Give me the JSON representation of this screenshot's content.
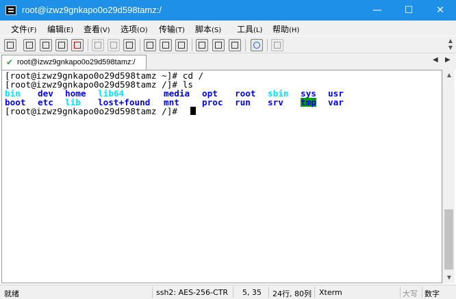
{
  "window": {
    "title": "root@izwz9gnkapo0o29d598tamz:/",
    "min_symbol": "—",
    "max_symbol": "☐",
    "close_symbol": "✕"
  },
  "menu": [
    {
      "label": "文件",
      "accel": "(F)"
    },
    {
      "label": "编辑",
      "accel": "(E)"
    },
    {
      "label": "查看",
      "accel": "(V)"
    },
    {
      "label": "选项",
      "accel": "(O)"
    },
    {
      "label": "传输",
      "accel": "(T)"
    },
    {
      "label": "脚本",
      "accel": "(S)"
    },
    {
      "label": "工具",
      "accel": "(L)"
    },
    {
      "label": "帮助",
      "accel": "(H)"
    }
  ],
  "toolbar_icons": [
    "connect-icon",
    "quick-connect-icon",
    "connect-tab-icon",
    "reconnect-icon",
    "disconnect-icon",
    "copy-icon",
    "paste-icon",
    "find-icon",
    "print-icon",
    "print-setup-icon",
    "printer-icon",
    "session-options-icon",
    "global-options-icon",
    "keymap-icon",
    "help-icon",
    "sftp-icon"
  ],
  "tab": {
    "label": "root@izwz9gnkapo0o29d598tamz:/",
    "status": "connected"
  },
  "colors": {
    "titlebar": "#1e90e8",
    "dir_blue": "#0000ff",
    "link_cyan": "#00e5ff",
    "tmp_bg": "#00a000",
    "tmp_fg": "#0000ff",
    "prompt": "#000000"
  },
  "terminal": {
    "line1": "[root@izwz9gnkapo0o29d598tamz ~]# cd /",
    "line2": "[root@izwz9gnkapo0o29d598tamz /]# ls",
    "prompt_last": "[root@izwz9gnkapo0o29d598tamz /]# ",
    "ls_row1": [
      {
        "name": "bin",
        "kind": "link"
      },
      {
        "name": "dev",
        "kind": "dir"
      },
      {
        "name": "home",
        "kind": "dir"
      },
      {
        "name": "lib64",
        "kind": "link"
      },
      {
        "name": "media",
        "kind": "dir"
      },
      {
        "name": "opt",
        "kind": "dir"
      },
      {
        "name": "root",
        "kind": "dir"
      },
      {
        "name": "sbin",
        "kind": "link"
      },
      {
        "name": "sys",
        "kind": "dir"
      },
      {
        "name": "usr",
        "kind": "dir"
      }
    ],
    "ls_row2": [
      {
        "name": "boot",
        "kind": "dir"
      },
      {
        "name": "etc",
        "kind": "dir"
      },
      {
        "name": "lib",
        "kind": "link"
      },
      {
        "name": "lost+found",
        "kind": "dir"
      },
      {
        "name": "mnt",
        "kind": "dir"
      },
      {
        "name": "proc",
        "kind": "dir"
      },
      {
        "name": "run",
        "kind": "dir"
      },
      {
        "name": "srv",
        "kind": "dir"
      },
      {
        "name": "tmp",
        "kind": "sticky"
      },
      {
        "name": "var",
        "kind": "dir"
      }
    ]
  },
  "statusbar": {
    "ready": "就绪",
    "cipher": "ssh2: AES-256-CTR",
    "cursor_pos": "5, 35",
    "size": "24行, 80列",
    "term_type": "Xterm",
    "caps": "大写",
    "num": "数字"
  }
}
